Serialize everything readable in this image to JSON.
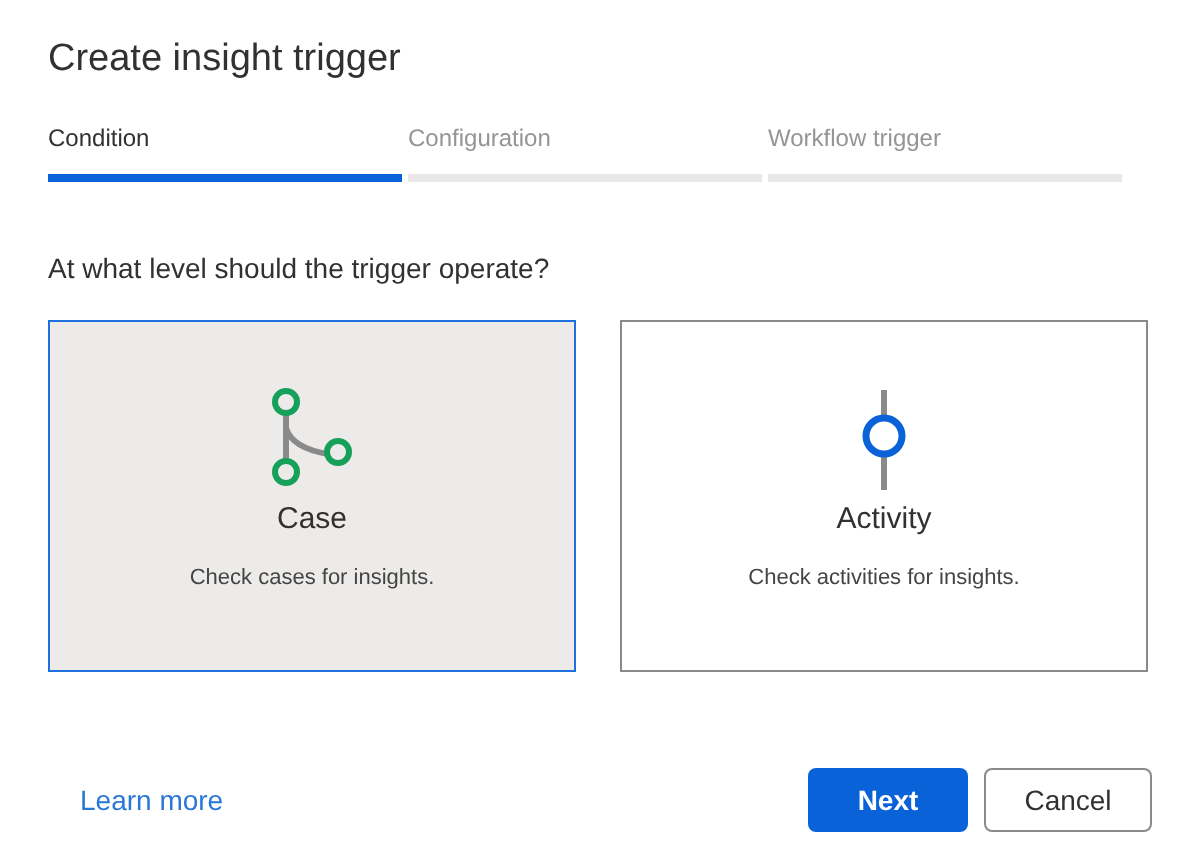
{
  "dialog": {
    "title": "Create insight trigger"
  },
  "steps": [
    {
      "label": "Condition",
      "selected": true
    },
    {
      "label": "Configuration",
      "selected": false
    },
    {
      "label": "Workflow trigger",
      "selected": false
    }
  ],
  "question": "At what level should the trigger operate?",
  "options": [
    {
      "kind": "case",
      "title": "Case",
      "description": "Check cases for insights.",
      "selected": true
    },
    {
      "kind": "activity",
      "title": "Activity",
      "description": "Check activities for insights.",
      "selected": false
    }
  ],
  "footer": {
    "link": "Learn more",
    "primary_button": "Next",
    "secondary_button": "Cancel"
  }
}
